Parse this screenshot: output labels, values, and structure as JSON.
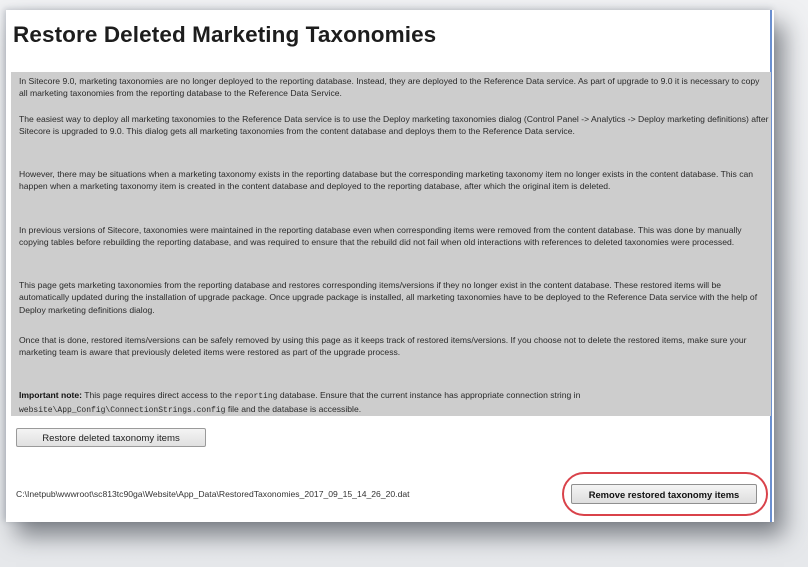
{
  "page": {
    "title": "Restore Deleted Marketing Taxonomies"
  },
  "paragraphs": {
    "p1": "In Sitecore 9.0, marketing taxonomies are no longer deployed to the reporting database. Instead, they are deployed to the Reference Data service. As part of upgrade to 9.0 it is necessary to copy all marketing taxonomies from the reporting database to the Reference Data Service.",
    "p2": "The easiest way to deploy all marketing taxonomies to the Reference Data service is to use the Deploy marketing taxonomies dialog (Control Panel -> Analytics -> Deploy marketing definitions) after Sitecore is upgraded to 9.0. This dialog gets all marketing taxonomies from the content database and deploys them to the Reference Data service.",
    "p3": "However, there may be situations when a marketing taxonomy exists in the reporting database but the corresponding marketing taxonomy item no longer exists in the content database. This can happen when a marketing taxonomy item is created in the content database and deployed to the reporting database, after which the original item is deleted.",
    "p4": "In previous versions of Sitecore, taxonomies were maintained in the reporting database even when corresponding items were removed from the content database. This was done by manually copying tables before rebuilding the reporting database, and was required to ensure that the rebuild did not fail when old interactions with references to deleted taxonomies were processed.",
    "p5": "This page gets marketing taxonomies from the reporting database and restores corresponding items/versions if they no longer exist in the content database. These restored items will be automatically updated during the installation of upgrade package. Once upgrade package is installed, all marketing taxonomies have to be deployed to the Reference Data service with the help of Deploy marketing definitions dialog.",
    "p6": "Once that is done, restored items/versions can be safely removed by using this page as it keeps track of restored items/versions. If you choose not to delete the restored items, make sure your marketing team is aware that previously deleted items were restored as part of the upgrade process.",
    "note_label": "Important note:",
    "note_text_1": " This page requires direct access to the ",
    "note_code_1": "reporting",
    "note_text_2": " database. Ensure that the current instance has appropriate connection string in ",
    "note_code_2": "website\\App_Config\\ConnectionStrings.config",
    "note_text_3": " file and the database is accessible."
  },
  "actions": {
    "restore_label": "Restore deleted taxonomy items",
    "remove_label": "Remove restored taxonomy items"
  },
  "file_path": "C:\\Inetpub\\wwwroot\\sc813tc90ga\\Website\\App_Data\\RestoredTaxonomies_2017_09_15_14_26_20.dat",
  "colors": {
    "highlight_ring": "#d9424a",
    "text_block_background": "#cdcdcd"
  }
}
